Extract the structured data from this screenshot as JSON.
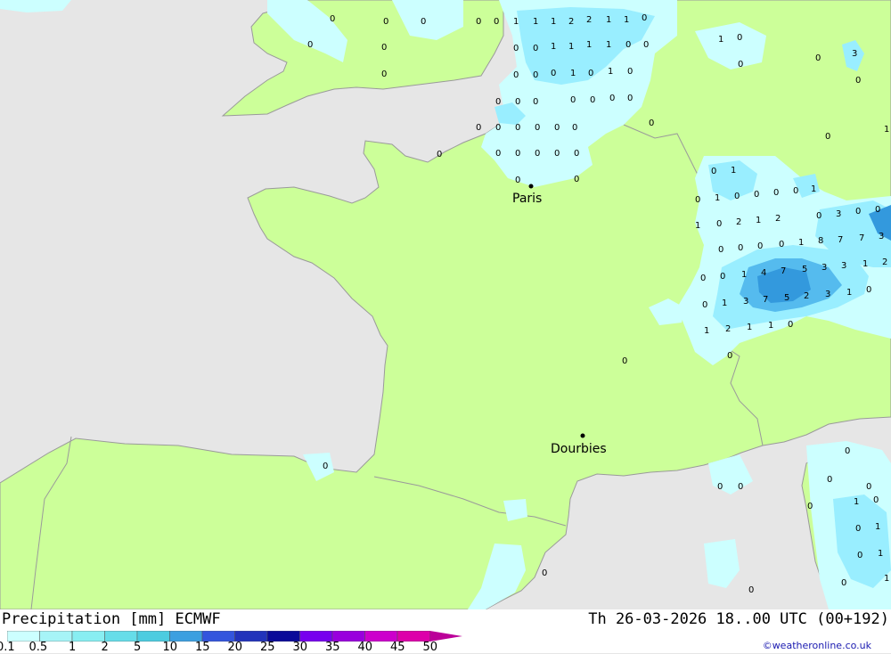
{
  "map": {
    "cities": [
      {
        "name": "Paris"
      },
      {
        "name": "Dourbies"
      }
    ],
    "colors": {
      "sea": "#e6e6e6",
      "land": "#ccff99",
      "precip_light": "#ccffff",
      "precip_mid": "#99eeff",
      "precip_heavy": "#55bbee",
      "precip_strong": "#3399dd"
    },
    "value_labels": [
      "0",
      "1",
      "2",
      "3",
      "4",
      "5",
      "7",
      "8"
    ]
  },
  "legend": {
    "title": "Precipitation [mm] ECMWF",
    "datetime": "Th 26-03-2026 18..00 UTC (00+192)",
    "credit": "©weatheronline.co.uk",
    "ticks": [
      "0.1",
      "0.5",
      "1",
      "2",
      "5",
      "10",
      "15",
      "20",
      "25",
      "30",
      "35",
      "40",
      "45",
      "50"
    ],
    "colors": [
      "#ccffff",
      "#a6f4f7",
      "#88eef2",
      "#66dde9",
      "#4ccce0",
      "#3c9fe0",
      "#3355dd",
      "#2233bb",
      "#0a0a99",
      "#7700ee",
      "#9900dd",
      "#cc00cc",
      "#dd00aa",
      "#bb0099"
    ]
  }
}
